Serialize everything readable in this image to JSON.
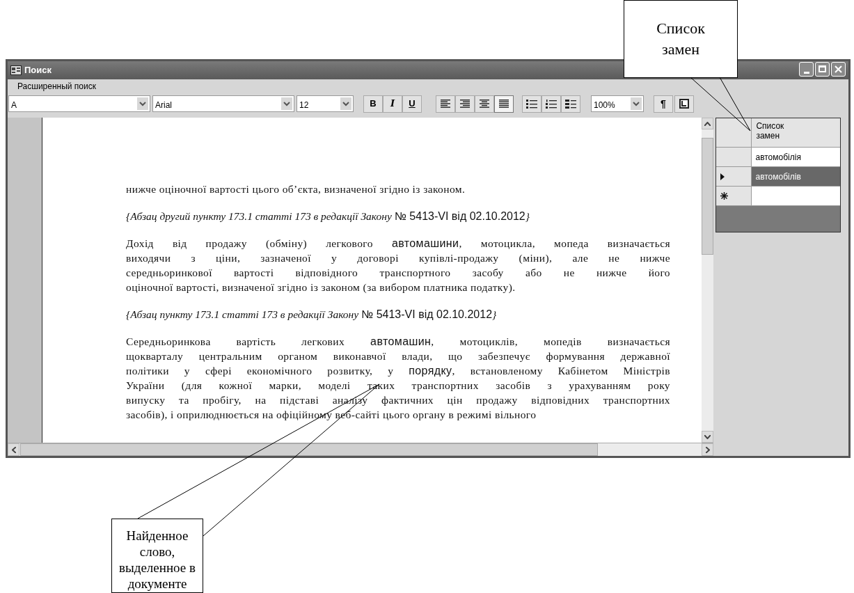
{
  "window": {
    "title": "Поиск"
  },
  "menu": [
    {
      "label": "Расширенный поиск"
    }
  ],
  "toolbar": {
    "style": "A",
    "font": "Arial",
    "size": "12",
    "zoom": "100%",
    "format_buttons": [
      {
        "kind": "bold",
        "label": "B"
      },
      {
        "kind": "italic",
        "label": "I"
      },
      {
        "kind": "underline",
        "label": "U"
      }
    ],
    "align_buttons": [
      {
        "kind": "left",
        "selected": false
      },
      {
        "kind": "right",
        "selected": false
      },
      {
        "kind": "center",
        "selected": false
      },
      {
        "kind": "justify",
        "selected": true
      }
    ],
    "list_buttons": [
      {
        "kind": "bullets"
      },
      {
        "kind": "numbers"
      },
      {
        "kind": "outline"
      }
    ],
    "pilcrow": "¶"
  },
  "document": {
    "paragraphs": [
      {
        "kind": "body",
        "lines": [
          [
            {
              "kind": "serif",
              "text": "нижче оціночної вартості цього об’єкта, визначеної згідно із законом."
            }
          ]
        ]
      },
      {
        "kind": "note",
        "lines": [
          [
            {
              "kind": "italic",
              "text": "{Абзац другий пункту 173.1 статті 173 в редакції Закону "
            },
            {
              "kind": "sans",
              "text": "№ 5413-VI від 02.10.2012"
            },
            {
              "kind": "italic",
              "text": "}"
            }
          ]
        ]
      },
      {
        "kind": "body",
        "lines": [
          [
            {
              "kind": "serif",
              "text": "Дохід від продажу (обміну) легкового "
            },
            {
              "kind": "sans",
              "text": "автомашини"
            },
            {
              "kind": "serif",
              "text": ", мотоцикла, мопеда визначається"
            }
          ],
          [
            {
              "kind": "serif",
              "text": "виходячи з ціни, зазначеної у договорі купівлі-продажу (міни), але не нижче"
            }
          ],
          [
            {
              "kind": "serif",
              "text": "середньоринкової вартості відповідного транспортного засобу або не нижче його"
            }
          ],
          [
            {
              "kind": "serif",
              "text": "оціночної вартості, визначеної згідно із законом (за вибором платника податку)."
            }
          ]
        ]
      },
      {
        "kind": "note",
        "lines": [
          [
            {
              "kind": "italic",
              "text": "{Абзац пункту 173.1 статті 173 в редакції Закону "
            },
            {
              "kind": "sans",
              "text": "№ 5413-VI від 02.10.2012"
            },
            {
              "kind": "italic",
              "text": "}"
            }
          ]
        ]
      },
      {
        "kind": "body",
        "lines": [
          [
            {
              "kind": "serif",
              "text": "Середньоринкова вартість легкових "
            },
            {
              "kind": "sans",
              "text": "автомашин"
            },
            {
              "kind": "serif",
              "text": ", мотоциклів, мопедів визначається"
            }
          ],
          [
            {
              "kind": "serif",
              "text": "щокварталу центральним органом виконавчої влади, що забезпечує формування державної"
            }
          ],
          [
            {
              "kind": "serif",
              "text": "політики у сфері економічного розвитку, у "
            },
            {
              "kind": "sans",
              "text": "порядку"
            },
            {
              "kind": "serif",
              "text": ", встановленому Кабінетом Міністрів"
            }
          ],
          [
            {
              "kind": "serif",
              "text": "України (для кожної марки, моделі таких транспортних засобів з урахуванням року"
            }
          ],
          [
            {
              "kind": "serif",
              "text": "випуску та пробігу, на підставі аналізу фактичних цін продажу відповідних транспортних"
            }
          ],
          [
            {
              "kind": "serif",
              "text": "засобів), і оприлюднюється на офіційному веб-сайті цього органу в режимі вільного"
            }
          ]
        ]
      }
    ]
  },
  "replacements": {
    "header": "Список замен",
    "rows": [
      {
        "kind": "item",
        "value": "автомобілія",
        "selected": false
      },
      {
        "kind": "item",
        "value": "автомобілів",
        "selected": true
      },
      {
        "kind": "new"
      }
    ]
  },
  "callouts": [
    {
      "text": "Список замен"
    },
    {
      "text": "Найденное слово, выделенное в документе"
    }
  ]
}
